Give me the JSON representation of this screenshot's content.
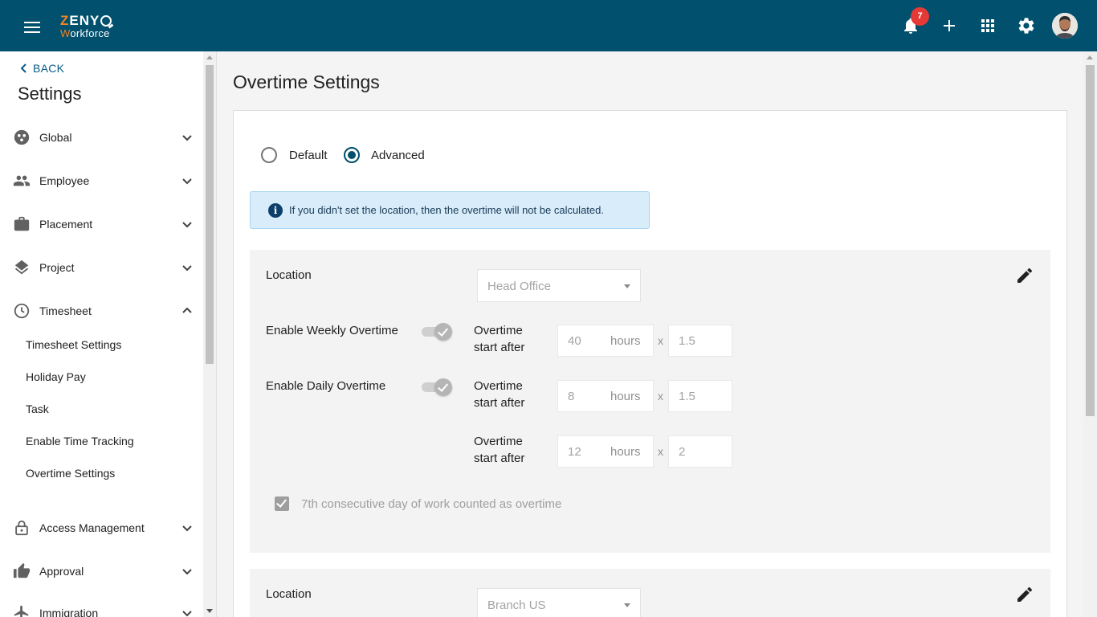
{
  "app": {
    "logo_top_z": "Z",
    "logo_top_rest": "ENY",
    "logo_bottom_w": "W",
    "logo_bottom_rest": "orkforce",
    "notification_count": "7"
  },
  "sidebar": {
    "back_label": "BACK",
    "title": "Settings",
    "items": [
      {
        "label": "Global",
        "icon": "globe-icon",
        "expanded": false
      },
      {
        "label": "Employee",
        "icon": "people-icon",
        "expanded": false
      },
      {
        "label": "Placement",
        "icon": "briefcase-icon",
        "expanded": false
      },
      {
        "label": "Project",
        "icon": "layers-icon",
        "expanded": false
      },
      {
        "label": "Timesheet",
        "icon": "clock-icon",
        "expanded": true
      },
      {
        "label": "Access Management",
        "icon": "lock-icon",
        "expanded": false
      },
      {
        "label": "Approval",
        "icon": "thumbs-up-icon",
        "expanded": false
      },
      {
        "label": "Immigration",
        "icon": "airplane-icon",
        "expanded": false
      }
    ],
    "timesheet_sub_items": [
      "Timesheet Settings",
      "Holiday Pay",
      "Task",
      "Enable Time Tracking",
      "Overtime Settings"
    ]
  },
  "main": {
    "title": "Overtime Settings",
    "mode_options": [
      {
        "label": "Default",
        "selected": false
      },
      {
        "label": "Advanced",
        "selected": true
      }
    ],
    "alert_text": "If you didn't set the location, then the overtime will not be calculated.",
    "panels": [
      {
        "location_label": "Location",
        "location_value": "Head Office",
        "weekly_label": "Enable Weekly Overtime",
        "weekly_enabled": true,
        "daily_label": "Enable Daily Overtime",
        "daily_enabled": true,
        "ot_start_line1": "Overtime",
        "ot_start_line2": "start after",
        "hours_unit": "hours",
        "mult_symbol": "x",
        "rules": [
          {
            "hours": "40",
            "multiplier": "1.5"
          },
          {
            "hours": "8",
            "multiplier": "1.5"
          },
          {
            "hours": "12",
            "multiplier": "2"
          }
        ],
        "seventh_day_label": "7th consecutive day of work counted as overtime",
        "seventh_day_checked": true
      },
      {
        "location_label": "Location",
        "location_value": "Branch US"
      }
    ]
  },
  "colors": {
    "topbar": "#00506e",
    "brand_orange": "#f58220",
    "accent": "#00506e",
    "badge": "#e53935",
    "alert_bg": "#d8ecfa"
  }
}
